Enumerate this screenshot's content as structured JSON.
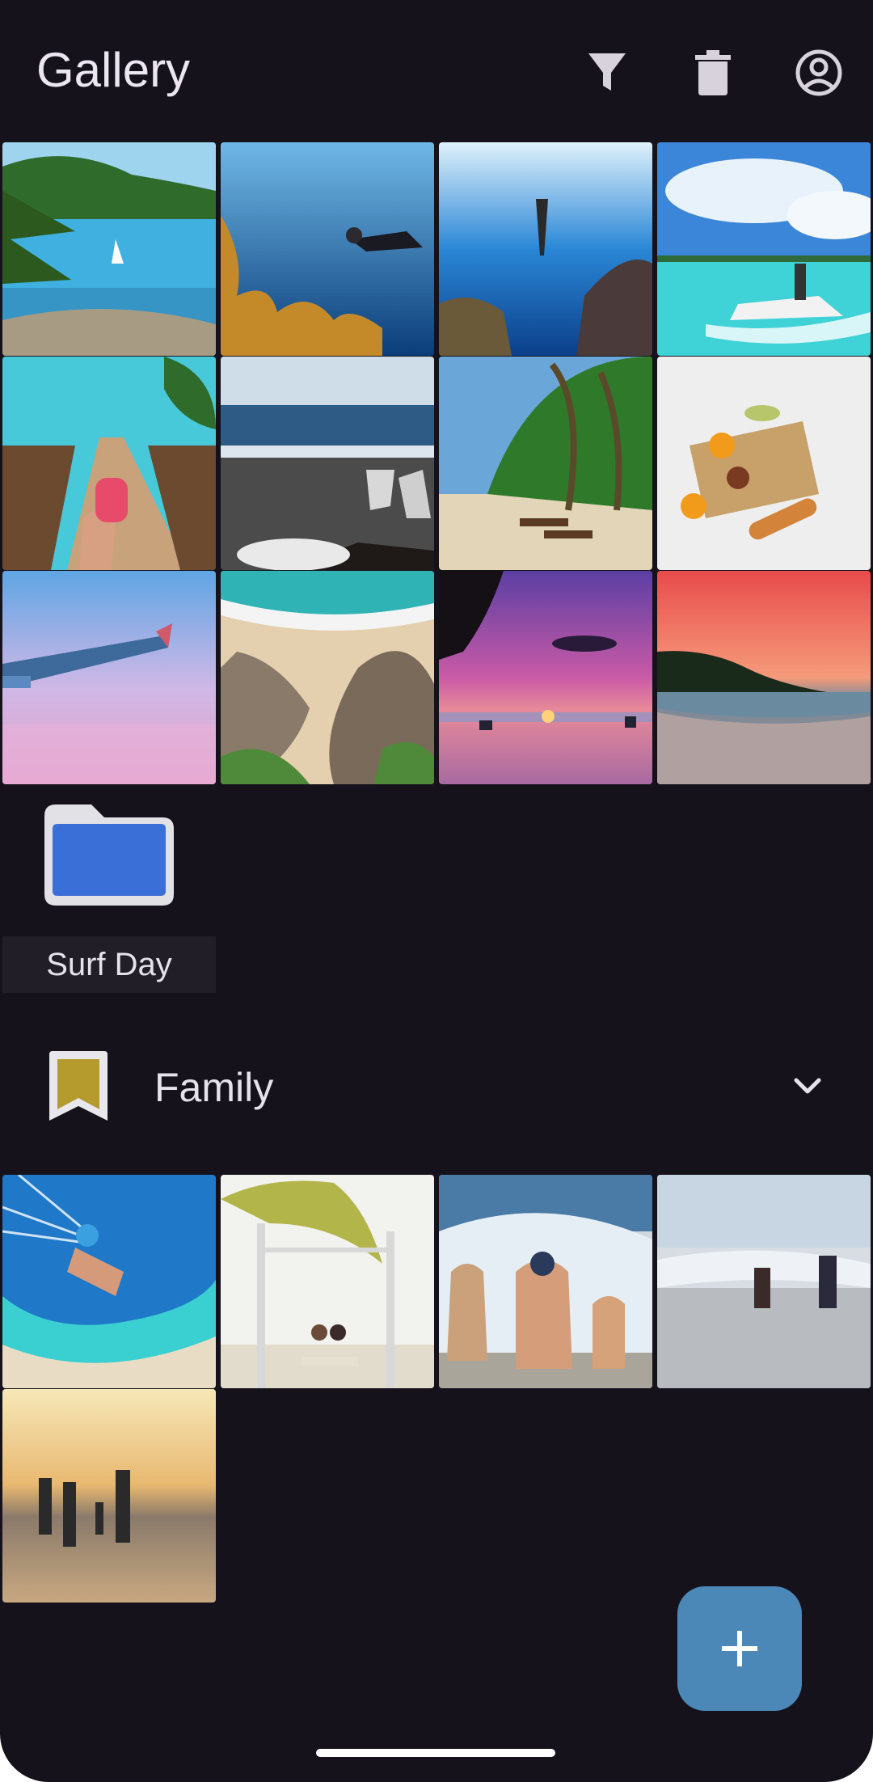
{
  "app": {
    "title": "Gallery"
  },
  "toolbar": {
    "filter_icon": "filter-icon",
    "delete_icon": "trash-icon",
    "account_icon": "account-circle-icon"
  },
  "photos": [
    "bay-with-sailboat",
    "diver-with-fish",
    "freediver-underwater",
    "jetski-turquoise",
    "cocktail-on-boardwalk",
    "feet-on-rocky-beach",
    "palm-beach-loungers",
    "picnic-blanket",
    "airplane-wing-pink-sky",
    "aerial-beach-rocks",
    "purple-sunset-beach",
    "orange-sunset-shore"
  ],
  "folder": {
    "label": "Surf Day",
    "icon": "folder-icon",
    "color": "#3b6fd8"
  },
  "album": {
    "title": "Family",
    "icon": "bookmark-icon",
    "icon_color": "#b59a2e",
    "chevron": "chevron-down-icon"
  },
  "album_photos": [
    "parasailing",
    "beach-swing",
    "kids-in-waves",
    "running-into-waves",
    "family-sunset"
  ],
  "fab": {
    "icon": "plus-icon",
    "color": "#4b88b7"
  }
}
